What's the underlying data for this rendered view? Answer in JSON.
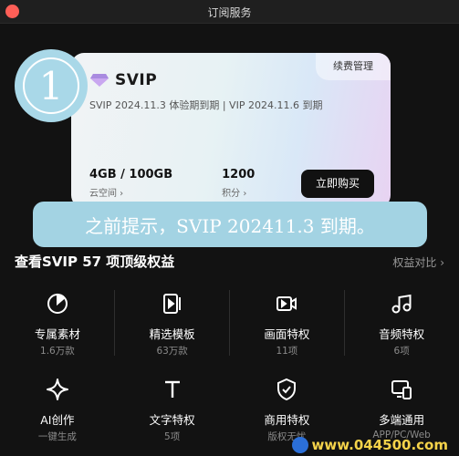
{
  "window": {
    "title": "订阅服务"
  },
  "card": {
    "manage_label": "续费管理",
    "tier": "SVIP",
    "expiry_text": "SVIP 2024.11.3 体验期到期 | VIP 2024.11.6 到期",
    "storage": {
      "value": "4GB / 100GB",
      "label": "云空间 ›"
    },
    "points": {
      "value": "1200",
      "label": "积分 ›"
    },
    "buy_label": "立即购买"
  },
  "overlay": {
    "step_number": "1",
    "caption": "之前提示，SVIP 202411.3 到期。"
  },
  "benefits": {
    "title": "查看SVIP 57 项顶级权益",
    "compare_label": "权益对比 ›",
    "items": [
      {
        "icon": "pie-chart-icon",
        "name": "专属素材",
        "sub": "1.6万款"
      },
      {
        "icon": "template-icon",
        "name": "精选模板",
        "sub": "63万款"
      },
      {
        "icon": "video-camera-icon",
        "name": "画面特权",
        "sub": "11项"
      },
      {
        "icon": "music-note-icon",
        "name": "音频特权",
        "sub": "6项"
      },
      {
        "icon": "sparkle-icon",
        "name": "AI创作",
        "sub": "一键生成"
      },
      {
        "icon": "text-icon",
        "name": "文字特权",
        "sub": "5项"
      },
      {
        "icon": "shield-check-icon",
        "name": "商用特权",
        "sub": "版权无忧"
      },
      {
        "icon": "multi-device-icon",
        "name": "多端通用",
        "sub": "APP/PC/Web"
      }
    ]
  },
  "watermark": {
    "text": "www.044500.com"
  },
  "colors": {
    "background": "#121212",
    "overlay_blue": "#a3d3e3",
    "buy_button": "#111111",
    "watermark": "#f5d34a"
  }
}
